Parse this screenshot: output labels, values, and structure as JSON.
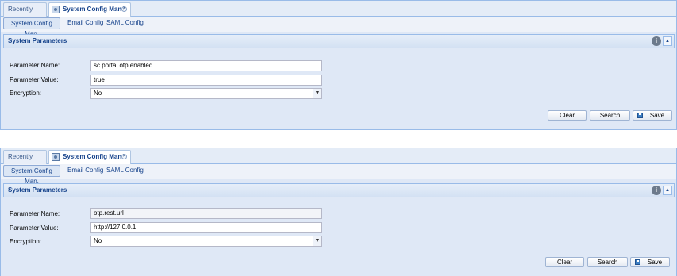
{
  "screens": [
    {
      "tabs": {
        "recent": "Recently View",
        "active": "System Config Man.",
        "close": "×"
      },
      "subtabs": {
        "active": "System Config Man.",
        "email": "Email Config",
        "saml": "SAML Config"
      },
      "section": {
        "title": "System Parameters",
        "help_icon": "info-icon",
        "collapse": "▲"
      },
      "form": {
        "name_label": "Parameter Name:",
        "name_value": "sc.portal.otp.enabled",
        "value_label": "Parameter Value:",
        "value_value": "true",
        "enc_label": "Encryption:",
        "enc_value": "No",
        "enc_trigger": "▼"
      },
      "buttons": {
        "clear": "Clear",
        "search": "Search",
        "save": "Save"
      }
    },
    {
      "tabs": {
        "recent": "Recently View",
        "active": "System Config Man.",
        "close": "×"
      },
      "subtabs": {
        "active": "System Config Man.",
        "email": "Email Config",
        "saml": "SAML Config"
      },
      "section": {
        "title": "System Parameters",
        "help_icon": "info-icon",
        "collapse": "▲"
      },
      "form": {
        "name_label": "Parameter Name:",
        "name_value": "otp.rest.url",
        "value_label": "Parameter Value:",
        "value_value": "http://127.0.0.1",
        "enc_label": "Encryption:",
        "enc_value": "No",
        "enc_trigger": "▼"
      },
      "buttons": {
        "clear": "Clear",
        "search": "Search",
        "save": "Save"
      }
    }
  ]
}
